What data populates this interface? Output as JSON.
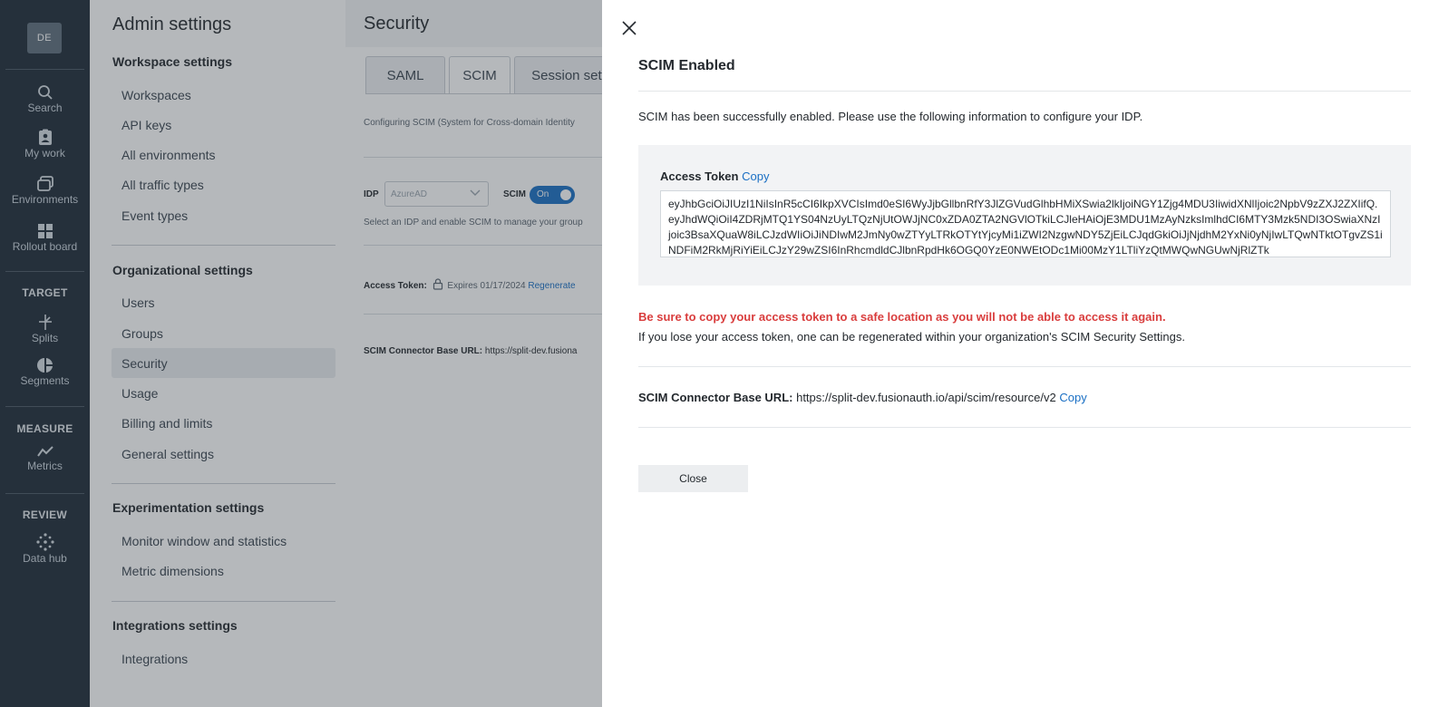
{
  "rail": {
    "avatar": "DE",
    "items": {
      "search": "Search",
      "my_work": "My work",
      "environments": "Environments",
      "rollout_board": "Rollout board",
      "splits": "Splits",
      "segments": "Segments",
      "metrics": "Metrics",
      "data_hub": "Data hub"
    },
    "sections": {
      "target": "TARGET",
      "measure": "MEASURE",
      "review": "REVIEW"
    }
  },
  "admin": {
    "title": "Admin settings",
    "workspace": {
      "heading": "Workspace settings",
      "items": [
        "Workspaces",
        "API keys",
        "All environments",
        "All traffic types",
        "Event types"
      ]
    },
    "organizational": {
      "heading": "Organizational settings",
      "items": [
        "Users",
        "Groups",
        "Security",
        "Usage",
        "Billing and limits",
        "General settings"
      ]
    },
    "experimentation": {
      "heading": "Experimentation settings",
      "items": [
        "Monitor window and statistics",
        "Metric dimensions"
      ]
    },
    "integrations": {
      "heading": "Integrations settings",
      "items": [
        "Integrations"
      ]
    }
  },
  "security": {
    "title": "Security",
    "tabs": [
      "SAML",
      "SCIM",
      "Session sett"
    ],
    "description": "Configuring SCIM (System for Cross-domain Identity",
    "idp_label": "IDP",
    "idp_value": "AzureAD",
    "scim_label": "SCIM",
    "scim_toggle": "On",
    "helper": "Select an IDP and enable SCIM to manage your group",
    "access_token_label": "Access Token:",
    "expires": "Expires 01/17/2024",
    "regenerate": "Regenerate",
    "base_url_label": "SCIM Connector Base URL:",
    "base_url_value": "https://split-dev.fusiona"
  },
  "panel": {
    "title": "SCIM Enabled",
    "intro": "SCIM has been successfully enabled. Please use the following information to configure your IDP.",
    "access_token_label": "Access Token",
    "copy_label": "Copy",
    "token": "eyJhbGciOiJIUzI1NiIsInR5cCI6IkpXVCIsImd0eSI6WyJjbGllbnRfY3JlZGVudGlhbHMiXSwia2lkIjoiNGY1Zjg4MDU3IiwidXNlIjoic2NpbV9zZXJ2ZXIifQ.eyJhdWQiOiI4ZDRjMTQ1YS04NzUyLTQzNjUtOWJjNC0xZDA0ZTA2NGVlOTkiLCJleHAiOjE3MDU1MzAyNzksImlhdCI6MTY3Mzk5NDI3OSwiaXNzIjoic3BsaXQuaW8iLCJzdWIiOiJiNDIwM2JmNy0wZTYyLTRkOTYtYjcyMi1iZWI2NzgwNDY5ZjEiLCJqdGkiOiJjNjdhM2YxNi0yNjIwLTQwNTktOTgvZS1iNDFiM2RkMjRiYiEiLCJzY29wZSI6InRhcmdldCJlbnRpdHk6OGQ0YzE0NWEtODc1Mi00MzY1LTliYzQtMWQwNGUwNjRlZTk",
    "warning": "Be sure to copy your access token to a safe location as you will not be able to access it again.",
    "regen_note": "If you lose your access token, one can be regenerated within your organization's SCIM Security Settings.",
    "base_url_label": "SCIM Connector Base URL:",
    "base_url_value": "https://split-dev.fusionauth.io/api/scim/resource/v2",
    "base_url_copy": "Copy",
    "close_button": "Close"
  }
}
